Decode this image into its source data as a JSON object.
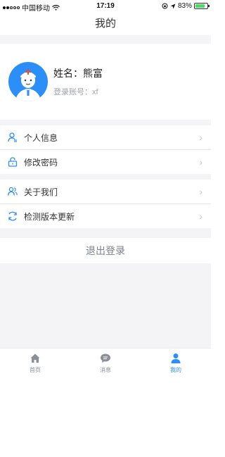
{
  "status_bar": {
    "carrier": "中国移动",
    "time": "17:19",
    "battery": "83%",
    "battery_level": 0.83
  },
  "nav": {
    "title": "我的"
  },
  "profile": {
    "name": "姓名：熊富",
    "account": "登录账号：xf"
  },
  "menu": {
    "group1": [
      {
        "label": "个人信息",
        "icon": "person-icon"
      },
      {
        "label": "修改密码",
        "icon": "lock-icon"
      }
    ],
    "group2": [
      {
        "label": "关于我们",
        "icon": "users-icon"
      },
      {
        "label": "检测版本更新",
        "icon": "refresh-icon"
      }
    ]
  },
  "logout_label": "退出登录",
  "tabs": [
    {
      "label": "首页",
      "icon": "home-icon",
      "active": false
    },
    {
      "label": "消息",
      "icon": "message-icon",
      "active": false
    },
    {
      "label": "我的",
      "icon": "user-icon",
      "active": true
    }
  ],
  "colors": {
    "accent": "#2c8ef8",
    "background": "#f4f4f6"
  }
}
